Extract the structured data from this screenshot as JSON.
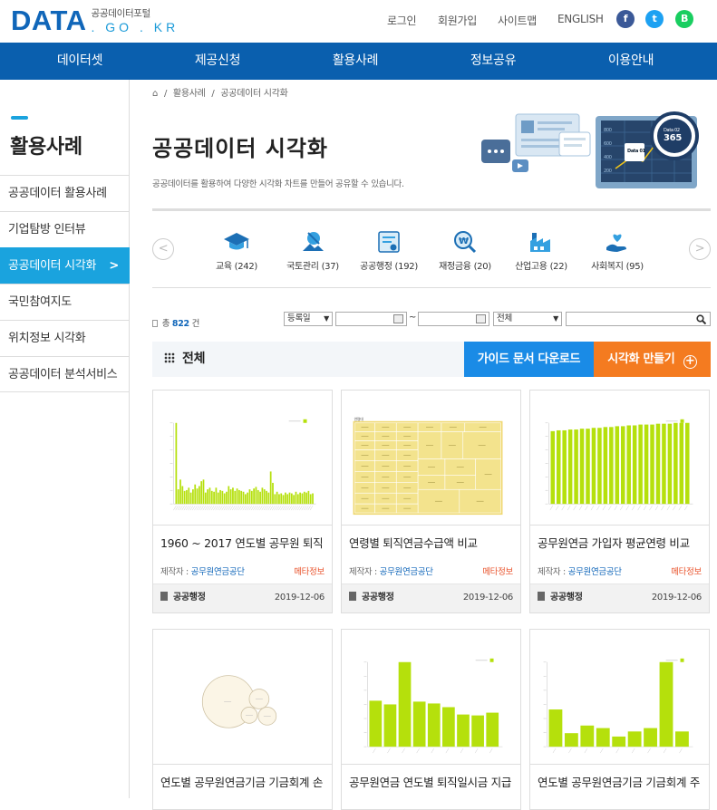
{
  "header": {
    "logo_main": "DATA",
    "logo_sub_ko": "공공데이터포털",
    "logo_domain": ". GO . KR",
    "links": [
      "로그인",
      "회원가입",
      "사이트맵",
      "ENGLISH"
    ],
    "sns": [
      {
        "name": "facebook-icon",
        "glyph": "f",
        "color": "#3b5998"
      },
      {
        "name": "twitter-icon",
        "glyph": "t",
        "color": "#1da1f2"
      },
      {
        "name": "blog-icon",
        "glyph": "B",
        "color": "#19ce60"
      }
    ]
  },
  "gnb": [
    "데이터셋",
    "제공신청",
    "활용사례",
    "정보공유",
    "이용안내"
  ],
  "lnb": {
    "title": "활용사례",
    "items": [
      "공공데이터 활용사례",
      "기업탐방 인터뷰",
      "공공데이터 시각화",
      "국민참여지도",
      "위치정보 시각화",
      "공공데이터 분석서비스"
    ],
    "active_index": 2
  },
  "breadcrumb": [
    "⌂",
    "/",
    "활용사례",
    "/",
    "공공데이터 시각화"
  ],
  "page": {
    "title": "공공데이터 시각화",
    "description": "공공데이터를 활용하여 다양한 시각화 차트를 만들어 공유할 수 있습니다.",
    "hero_badge_a": "Data 01",
    "hero_badge_b": "Data 02",
    "hero_badge_num": "365",
    "hero_axis": [
      "800",
      "600",
      "400",
      "200"
    ]
  },
  "categories": [
    {
      "label": "교육 (242)",
      "icon": "graduation-cap-icon"
    },
    {
      "label": "국토관리 (37)",
      "icon": "land-management-icon"
    },
    {
      "label": "공공행정 (192)",
      "icon": "certificate-icon"
    },
    {
      "label": "재정금융 (20)",
      "icon": "won-search-icon"
    },
    {
      "label": "산업고용 (22)",
      "icon": "factory-icon"
    },
    {
      "label": "사회복지 (95)",
      "icon": "care-hand-icon"
    }
  ],
  "filter": {
    "count_prefix": "총",
    "count": "822",
    "count_suffix": "건",
    "sort_value": "등록일",
    "date_sep": "~",
    "type_value": "전체",
    "search_placeholder": ""
  },
  "toolbar": {
    "title": "전체",
    "guide_button": "가이드 문서 다운로드",
    "make_button": "시각화 만들기"
  },
  "card_common": {
    "maker_label": "제작자 : ",
    "maker": "공무원연금공단",
    "meta_link": "메타정보"
  },
  "cards": [
    {
      "title": "1960 ~ 2017 연도별 공무원 퇴직",
      "category": "공공행정",
      "date": "2019-12-06",
      "thumb": "bar-dense"
    },
    {
      "title": "연령별 퇴직연금수급액 비교",
      "category": "공공행정",
      "date": "2019-12-06",
      "thumb": "treemap"
    },
    {
      "title": "공무원연금 가입자 평균연령 비교",
      "category": "공공행정",
      "date": "2019-12-06",
      "thumb": "bar-even"
    },
    {
      "title": "연도별 공무원연금기금 기금회계 손",
      "category": "",
      "date": "",
      "thumb": "bubble"
    },
    {
      "title": "공무원연금 연도별 퇴직일시금 지급",
      "category": "",
      "date": "",
      "thumb": "bar-ten"
    },
    {
      "title": "연도별 공무원연금기금 기금회계 주",
      "category": "",
      "date": "",
      "thumb": "bar-spike"
    }
  ],
  "colors": {
    "primary": "#0a5fae",
    "accent": "#1aa3de",
    "chart": "#b5e00c",
    "orange": "#f47b20",
    "blue_button": "#1a8be6"
  },
  "thumb_data": {
    "dense": [
      100,
      18,
      30,
      22,
      16,
      17,
      20,
      14,
      18,
      24,
      19,
      22,
      28,
      30,
      14,
      18,
      20,
      16,
      15,
      20,
      14,
      17,
      16,
      13,
      15,
      22,
      18,
      20,
      16,
      19,
      17,
      16,
      15,
      12,
      14,
      18,
      16,
      19,
      21,
      17,
      15,
      20,
      18,
      16,
      14,
      40,
      26,
      12,
      15,
      12,
      13,
      11,
      14,
      12,
      14,
      13,
      11,
      15,
      12,
      14,
      13,
      15,
      14,
      16,
      12,
      13
    ],
    "even": [
      88,
      89,
      89,
      90,
      90,
      91,
      91,
      92,
      92,
      93,
      93,
      94,
      94,
      95,
      95,
      96,
      96,
      96,
      97,
      97,
      97,
      98,
      98,
      98
    ],
    "ten": [
      50,
      46,
      92,
      49,
      47,
      43,
      35,
      34,
      37
    ],
    "spike": [
      44,
      16,
      25,
      22,
      12,
      18,
      22,
      100,
      18
    ],
    "treemap_label": "연령대"
  }
}
